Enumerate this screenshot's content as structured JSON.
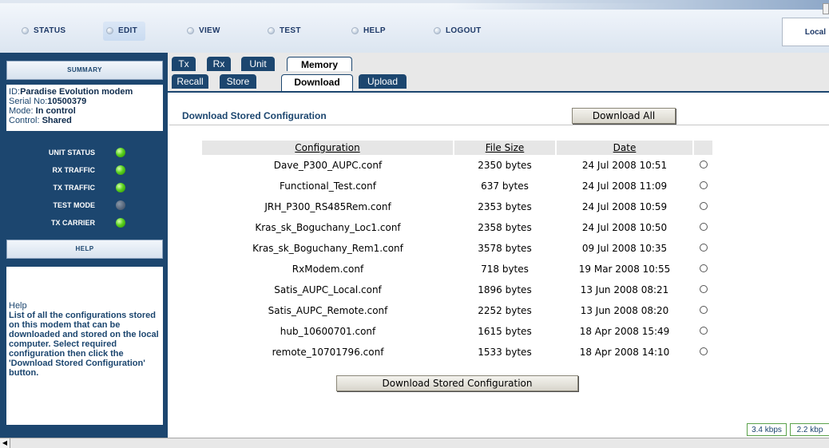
{
  "nav": {
    "items": [
      "STATUS",
      "EDIT",
      "VIEW",
      "TEST",
      "HELP",
      "LOGOUT"
    ],
    "active": "EDIT",
    "mode_label": "Local"
  },
  "sidebar": {
    "summary_title": "SUMMARY",
    "id_label": "ID:",
    "id_value": "Paradise Evolution modem",
    "serial_label": "Serial No:",
    "serial_value": "10500379",
    "mode_label": "Mode: ",
    "mode_value": "In control",
    "control_label": "Control: ",
    "control_value": "Shared",
    "status_items": [
      {
        "label": "UNIT STATUS",
        "state": "on"
      },
      {
        "label": "RX TRAFFIC",
        "state": "on"
      },
      {
        "label": "TX TRAFFIC",
        "state": "on"
      },
      {
        "label": "TEST MODE",
        "state": "off"
      },
      {
        "label": "TX CARRIER",
        "state": "on"
      }
    ],
    "help_title": "HELP",
    "help_heading": "Help",
    "help_text": "List of all the configurations stored on this modem that can be downloaded and stored on the local computer. Select required configuration then click the 'Download Stored Configuration' button."
  },
  "tabs": {
    "row1": [
      "Tx",
      "Rx",
      "Unit",
      "Memory"
    ],
    "row1_selected": "Memory",
    "row2": [
      "Recall",
      "Store",
      "Download",
      "Upload"
    ],
    "row2_selected": "Download"
  },
  "main": {
    "section_title": "Download Stored Configuration",
    "download_all_label": "Download All",
    "download_stored_label": "Download Stored Configuration",
    "columns": [
      "Configuration",
      "File Size",
      "Date",
      ""
    ],
    "rows": [
      {
        "name": "Dave_P300_AUPC.conf",
        "size": "2350 bytes",
        "date": "24 Jul 2008 10:51"
      },
      {
        "name": "Functional_Test.conf",
        "size": "637 bytes",
        "date": "24 Jul 2008 11:09"
      },
      {
        "name": "JRH_P300_RS485Rem.conf",
        "size": "2353 bytes",
        "date": "24 Jul 2008 10:59"
      },
      {
        "name": "Kras_sk_Boguchany_Loc1.conf",
        "size": "2358 bytes",
        "date": "24 Jul 2008 10:50"
      },
      {
        "name": "Kras_sk_Boguchany_Rem1.conf",
        "size": "3578 bytes",
        "date": "09 Jul 2008 10:35"
      },
      {
        "name": "RxModem.conf",
        "size": "718 bytes",
        "date": "19 Mar 2008 10:55"
      },
      {
        "name": "Satis_AUPC_Local.conf",
        "size": "1896 bytes",
        "date": "13 Jun 2008 08:21"
      },
      {
        "name": "Satis_AUPC_Remote.conf",
        "size": "2252 bytes",
        "date": "13 Jun 2008 08:20"
      },
      {
        "name": "hub_10600701.conf",
        "size": "1615 bytes",
        "date": "18 Apr 2008 15:49"
      },
      {
        "name": "remote_10701796.conf",
        "size": "1533 bytes",
        "date": "18 Apr 2008 14:10"
      }
    ]
  },
  "footer": {
    "rx_rate": "3.4 kbps",
    "tx_rate": "2.2 kbp"
  }
}
